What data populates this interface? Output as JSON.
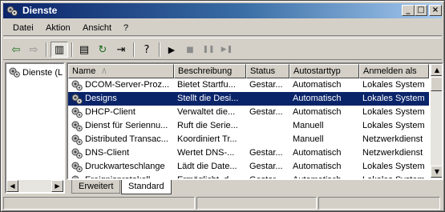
{
  "window": {
    "title": "Dienste",
    "icon": "gears-icon"
  },
  "titlebar_buttons": {
    "minimize": "_",
    "maximize": "□",
    "close": "×"
  },
  "menu": [
    "Datei",
    "Aktion",
    "Ansicht",
    "?"
  ],
  "toolbar": {
    "icons": [
      "back-arrow-icon",
      "forward-arrow-icon",
      "show-tree-icon",
      "properties-icon",
      "refresh-icon",
      "export-list-icon",
      "help-icon",
      "play-icon",
      "stop-icon",
      "pause-icon",
      "restart-icon"
    ],
    "glyphs": {
      "back": "⇦",
      "forward": "⇨",
      "tree": "▥",
      "props": "▤",
      "refresh": "↻",
      "export": "⇥",
      "help": "?",
      "play": "▶",
      "stop": "■",
      "pause": "❚❚",
      "restart": "▶❚"
    }
  },
  "tree": {
    "label": "Dienste (L"
  },
  "columns": [
    "Name",
    "Beschreibung",
    "Status",
    "Autostarttyp",
    "Anmelden als"
  ],
  "sort_indicator": "/\\",
  "rows": [
    {
      "name": "DCOM-Server-Proz...",
      "desc": "Bietet Startfu...",
      "status": "Gestar...",
      "start": "Automatisch",
      "logon": "Lokales System"
    },
    {
      "name": "Designs",
      "desc": "Stellt die Desi...",
      "status": "",
      "start": "Automatisch",
      "logon": "Lokales System"
    },
    {
      "name": "DHCP-Client",
      "desc": "Verwaltet die...",
      "status": "Gestar...",
      "start": "Automatisch",
      "logon": "Lokales System"
    },
    {
      "name": "Dienst für Seriennu...",
      "desc": "Ruft die Serie...",
      "status": "",
      "start": "Manuell",
      "logon": "Lokales System"
    },
    {
      "name": "Distributed Transac...",
      "desc": "Koordiniert Tr...",
      "status": "",
      "start": "Manuell",
      "logon": "Netzwerkdienst"
    },
    {
      "name": "DNS-Client",
      "desc": "Wertet DNS-...",
      "status": "Gestar...",
      "start": "Automatisch",
      "logon": "Netzwerkdienst"
    },
    {
      "name": "Druckwarteschlange",
      "desc": "Lädt die Date...",
      "status": "Gestar...",
      "start": "Automatisch",
      "logon": "Lokales System"
    },
    {
      "name": "Ereignisprotokoll",
      "desc": "Ermöglicht, d...",
      "status": "Gestar...",
      "start": "Automatisch",
      "logon": "Lokales System"
    }
  ],
  "selected_row": 1,
  "tabs": [
    "Erweitert",
    "Standard"
  ],
  "active_tab": "Standard",
  "scroll_arrows": {
    "up": "▲",
    "down": "▼",
    "left": "◀",
    "right": "▶"
  },
  "colors": {
    "titlebar": "#0a246a",
    "selection": "#0a246a",
    "face": "#d4d0c8"
  }
}
